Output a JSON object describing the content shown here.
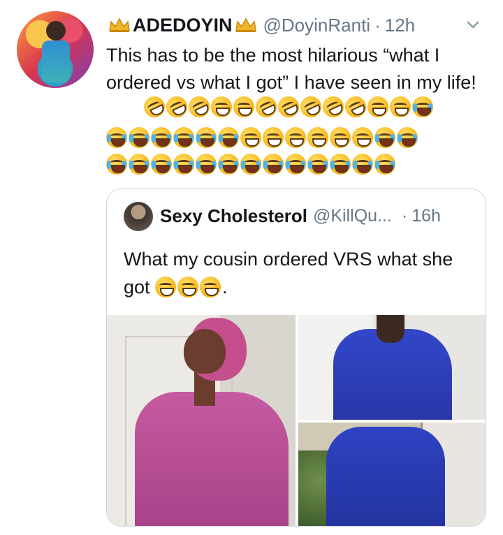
{
  "tweet": {
    "display_name": "ADEDOYIN",
    "handle": "@DoyinRanti",
    "dot": "·",
    "time": "12h",
    "text": "This has to be the most hilarious “what I ordered vs what I got” I have seen in my life!",
    "emoji_rows": [
      [
        "rofl",
        "rofl",
        "rofl",
        "grin-sweat",
        "grin-sweat",
        "rofl",
        "rofl",
        "rofl",
        "rofl",
        "rofl",
        "grin-sweat",
        "grin-sweat",
        "cry"
      ],
      [
        "cry",
        "cry",
        "cry",
        "cry",
        "cry",
        "cry",
        "grin-sweat",
        "grin-sweat",
        "grin-sweat",
        "grin-sweat",
        "grin-sweat",
        "grin-sweat",
        "cry",
        "cry"
      ],
      [
        "cry",
        "cry",
        "cry",
        "cry",
        "cry",
        "cry",
        "cry",
        "cry",
        "cry",
        "cry",
        "cry",
        "cry",
        "cry"
      ]
    ]
  },
  "quoted": {
    "display_name": "Sexy Cholesterol",
    "handle": "@KillQu...",
    "dot": "·",
    "time": "16h",
    "text": "What my cousin ordered VRS what she got",
    "trailing": ".",
    "emojis": [
      "grin-sweat",
      "grin-sweat",
      "grin-sweat"
    ],
    "photos": [
      "pink-dress-photo",
      "blue-dress-front-photo",
      "blue-dress-back-photo"
    ]
  },
  "colors": {
    "text": "#14171a",
    "secondary": "#657786",
    "border": "#ccd6dd"
  },
  "icons": {
    "crown": "crown-icon",
    "caret": "chevron-down-icon"
  }
}
